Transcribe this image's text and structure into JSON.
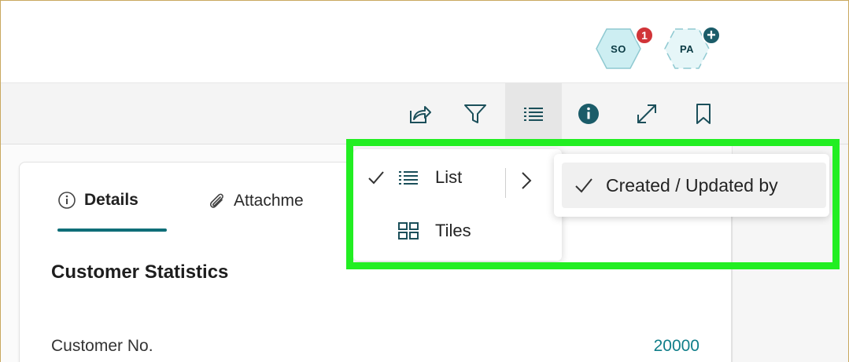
{
  "header": {
    "avatars": [
      {
        "initials": "SO",
        "badge": "1",
        "badge_color": "#d13438"
      },
      {
        "initials": "PA",
        "badge": "+",
        "badge_color": "#1b5c69"
      }
    ]
  },
  "toolbar": {
    "icons": [
      "share-icon",
      "filter-icon",
      "list-view-icon",
      "info-icon",
      "expand-icon",
      "bookmark-icon"
    ],
    "active": "list-view-icon"
  },
  "menu": {
    "list_label": "List",
    "tiles_label": "Tiles",
    "submenu_label": "Created / Updated by"
  },
  "card": {
    "tabs": [
      {
        "label": "Details",
        "active": true
      },
      {
        "label": "Attachme"
      }
    ],
    "section_title": "Customer Statistics",
    "field_label": "Customer No.",
    "field_value": "20000"
  },
  "colors": {
    "accent": "#0f6e78",
    "highlight": "#22ee22",
    "value_text": "#107e89"
  }
}
